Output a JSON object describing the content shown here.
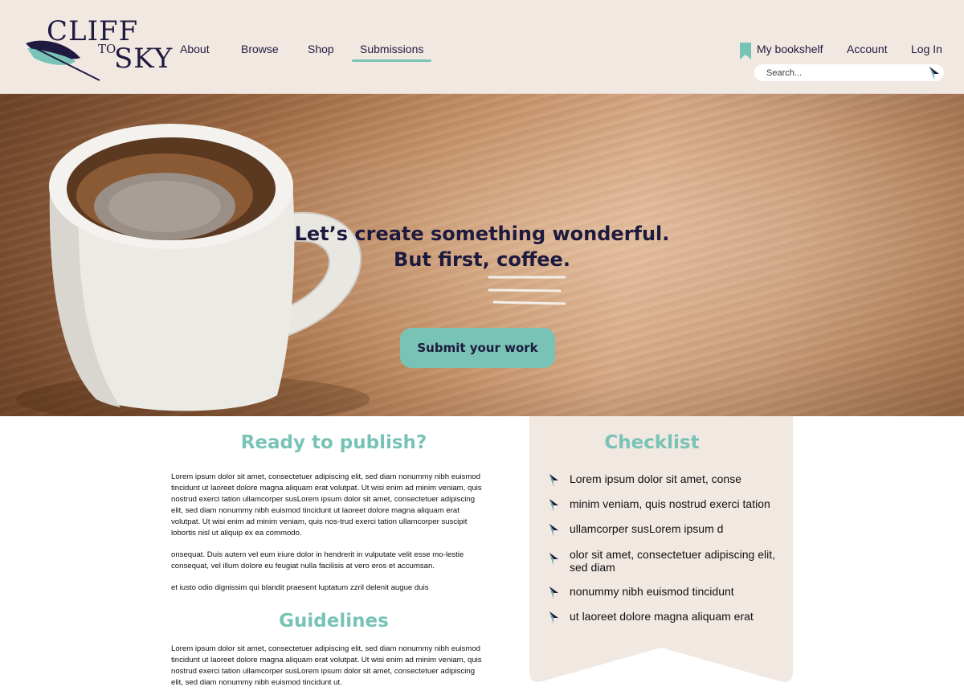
{
  "brand": {
    "line1": "CLIFF",
    "line2": "TO",
    "line3": "SKY"
  },
  "nav": {
    "items": [
      {
        "label": "About"
      },
      {
        "label": "Browse"
      },
      {
        "label": "Shop"
      },
      {
        "label": "Submissions",
        "active": true
      }
    ]
  },
  "header": {
    "bookshelf_label": "My bookshelf",
    "account_label": "Account",
    "login_label": "Log In"
  },
  "search": {
    "placeholder": "Search..."
  },
  "hero": {
    "title_line1": "Let’s create something wonderful.",
    "title_line2": "But first, coffee.",
    "cta_label": "Submit your work"
  },
  "publish": {
    "title": "Ready to publish?",
    "paragraphs": [
      "Lorem ipsum dolor sit amet, consectetuer adipiscing elit, sed diam nonummy nibh euismod tincidunt ut laoreet dolore magna aliquam erat volutpat. Ut wisi enim ad minim veniam, quis nostrud exerci tation ullamcorper susLorem ipsum dolor sit amet, consectetuer adipiscing elit, sed diam nonummy nibh euismod tincidunt ut laoreet dolore magna aliquam erat volutpat. Ut wisi enim ad minim veniam, quis nos-trud exerci tation ullamcorper suscipit lobortis nisl ut aliquip ex ea commodo.",
      "onsequat. Duis autem vel eum iriure dolor in hendrerit in vulputate velit esse mo-lestie consequat, vel illum dolore eu feugiat nulla facilisis at vero eros et accumsan.",
      "et iusto odio dignissim qui blandit praesent luptatum zzril delenit augue duis"
    ]
  },
  "guidelines": {
    "title": "Guidelines",
    "paragraph": "Lorem ipsum dolor sit amet, consectetuer adipiscing elit, sed diam nonummy nibh euismod tincidunt ut laoreet dolore magna aliquam erat volutpat. Ut wisi enim ad minim veniam, quis nostrud exerci tation ullamcorper susLorem ipsum dolor sit amet, consectetuer adipiscing elit, sed diam nonummy nibh euismod tincidunt ut."
  },
  "checklist": {
    "title": "Checklist",
    "items": [
      "Lorem ipsum dolor sit amet, conse",
      "minim veniam, quis nostrud exerci tation",
      "ullamcorper susLorem ipsum d",
      "olor sit amet, consectetuer adipiscing elit, sed diam",
      "nonummy nibh euismod tincidunt",
      "ut laoreet dolore magna aliquam erat"
    ]
  },
  "colors": {
    "accent": "#78c3b6",
    "navy": "#1d1a3f",
    "header_bg": "#f1e8e2"
  }
}
